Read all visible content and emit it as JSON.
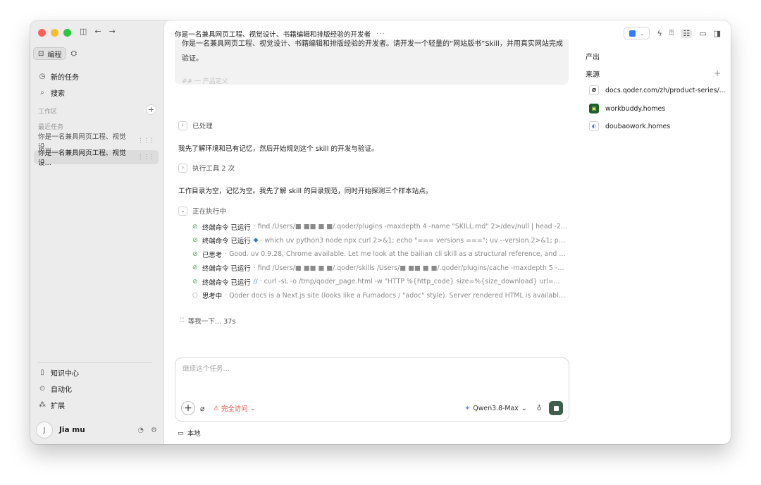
{
  "sidebar": {
    "tabs": {
      "active_label": "编程"
    },
    "nav": {
      "new_task": "新的任务",
      "search": "搜索"
    },
    "workspace_label": "工作区",
    "recent_label": "最近任务",
    "recent_tasks": [
      {
        "title": "你是一名兼具网页工程、视觉设..."
      },
      {
        "title": "你是一名兼具网页工程、视觉设..."
      }
    ],
    "bottom_nav": {
      "knowledge": "知识中心",
      "automation": "自动化",
      "extensions": "扩展"
    },
    "user": {
      "initial": "J",
      "name": "Jia mu"
    }
  },
  "main": {
    "title": "你是一名兼具网页工程、视觉设计、书籍编辑和排版经验的开发者",
    "title_more": "···",
    "prompt": {
      "line_cut": "你是一名兼具网页工程、视觉设计、书籍编辑和排版经验的开发者。请开发一个轻量的“网站版书”Skill，并用真实网站完成",
      "line2": "验证。",
      "faded": "## 一 产品定义"
    },
    "steps": {
      "processed": "已处理",
      "msg1": "我先了解环境和已有记忆，然后开始规划这个 skill 的开发与验证。",
      "tools_run": "执行工具 2 次",
      "msg2": "工作目录为空，记忆为空。我先了解 skill 的目录规范，同时开始探测三个样本站点。",
      "running": "正在执行中"
    },
    "sub_steps": [
      {
        "label": "终端命令 已运行",
        "cmd": "· find /Users/■ ■■ ■ ■/.qoder/plugins -maxdepth 4 -name \"SKILL.md\" 2>/dev/null | head -2..."
      },
      {
        "label": "终端命令 已运行",
        "cmd": "· which uv python3 node npx curl 2>&1; echo \"=== versions ===\"; uv --version 2>&1; pyth..."
      },
      {
        "label": "已思考",
        "cmd": "· Good. uv 0.9.28, Chrome available. Let me look at the bailian cli skill as a structural reference, and ch..."
      },
      {
        "label": "终端命令 已运行",
        "cmd": "· find /Users/■ ■■ ■ ■/.qoder/skills /Users/■ ■■ ■ ■/.qoder/plugins/cache -maxdepth 5 -n..."
      },
      {
        "label": "终端命令 已运行",
        "cmd": "· curl -sL -o /tmp/qoder_page.html -w \"HTTP %{http_code} size=%{size_download} url=..."
      },
      {
        "label": "思考中",
        "cmd": "· Qoder docs is a Next.js site (looks like a Fumadocs / \"adoc\" style). Server rendered HTML is available..."
      }
    ],
    "waiting": "等我一下... 37s",
    "composer": {
      "placeholder": "继续这个任务...",
      "access_label": "完全访问",
      "model": "Qwen3.8-Max"
    },
    "env_label": "本地"
  },
  "right_panel": {
    "output_title": "产出",
    "sources_title": "来源",
    "sources": [
      {
        "name": "docs.qoder.com/zh/product-series/..."
      },
      {
        "name": "workbuddy.homes"
      },
      {
        "name": "doubaowork.homes"
      }
    ]
  },
  "colors": {
    "stop_button": "#3e5f4e",
    "access_warning": "#e04a3a",
    "success_check": "#4aa35a",
    "ide_blue": "#2f7df6"
  },
  "icons": [
    "sidebar-toggle-icon",
    "back-arrow-icon",
    "forward-arrow-icon",
    "code-icon",
    "workspace-icon",
    "clock-icon",
    "search-icon",
    "book-icon",
    "automation-icon",
    "extensions-icon",
    "gauge-icon",
    "settings-icon",
    "bolt-icon",
    "help-icon",
    "list-icon",
    "panel-bottom-icon",
    "panel-right-icon",
    "attach-icon",
    "warning-icon",
    "sparkle-icon",
    "mic-icon",
    "monitor-icon"
  ]
}
